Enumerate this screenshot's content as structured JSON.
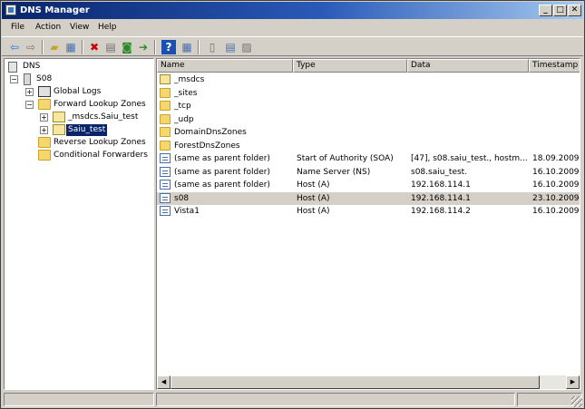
{
  "window": {
    "title": "DNS Manager"
  },
  "titlebar": {
    "minimize": "_",
    "maximize": "□",
    "close": "✕"
  },
  "menu": [
    "File",
    "Action",
    "View",
    "Help"
  ],
  "toolbar": {
    "icons": [
      "back-arrow-icon",
      "forward-arrow-icon",
      "up-folder-icon",
      "show-hide-tree-icon",
      "delete-icon",
      "properties-icon",
      "refresh-icon",
      "export-list-icon",
      "help-icon",
      "console-tree-icon",
      "new-host-record-icon",
      "new-alias-record-icon",
      "new-mx-record-icon"
    ],
    "colors": {
      "delete": "#d00000",
      "help": "#1c4fb3",
      "nav": "#2a7bd0"
    }
  },
  "tree": {
    "root": "DNS",
    "server": "S08",
    "global_logs": "Global Logs",
    "forward_zones": "Forward Lookup Zones",
    "zone_msdcs": "_msdcs.Saiu_test",
    "zone_selected": "Saiu_test",
    "reverse_zones": "Reverse Lookup Zones",
    "conditional_forwarders": "Conditional Forwarders"
  },
  "list": {
    "columns": [
      "Name",
      "Type",
      "Data",
      "Timestamp"
    ],
    "rows": [
      {
        "icon": "zone",
        "name": "_msdcs",
        "type": "",
        "data": "",
        "timestamp": ""
      },
      {
        "icon": "folder",
        "name": "_sites",
        "type": "",
        "data": "",
        "timestamp": ""
      },
      {
        "icon": "folder",
        "name": "_tcp",
        "type": "",
        "data": "",
        "timestamp": ""
      },
      {
        "icon": "folder",
        "name": "_udp",
        "type": "",
        "data": "",
        "timestamp": ""
      },
      {
        "icon": "folder",
        "name": "DomainDnsZones",
        "type": "",
        "data": "",
        "timestamp": ""
      },
      {
        "icon": "folder",
        "name": "ForestDnsZones",
        "type": "",
        "data": "",
        "timestamp": ""
      },
      {
        "icon": "record",
        "name": "(same as parent folder)",
        "type": "Start of Authority (SOA)",
        "data": "[47], s08.saiu_test., hostm...",
        "timestamp": "18.09.2009"
      },
      {
        "icon": "record",
        "name": "(same as parent folder)",
        "type": "Name Server (NS)",
        "data": "s08.saiu_test.",
        "timestamp": "16.10.2009"
      },
      {
        "icon": "record",
        "name": "(same as parent folder)",
        "type": "Host (A)",
        "data": "192.168.114.1",
        "timestamp": "16.10.2009"
      },
      {
        "icon": "record",
        "name": "s08",
        "type": "Host (A)",
        "data": "192.168.114.1",
        "timestamp": "23.10.2009",
        "selected": true
      },
      {
        "icon": "record",
        "name": "Vista1",
        "type": "Host (A)",
        "data": "192.168.114.2",
        "timestamp": "16.10.2009"
      }
    ]
  },
  "scroll": {
    "left_arrow": "◀",
    "right_arrow": "▶"
  }
}
